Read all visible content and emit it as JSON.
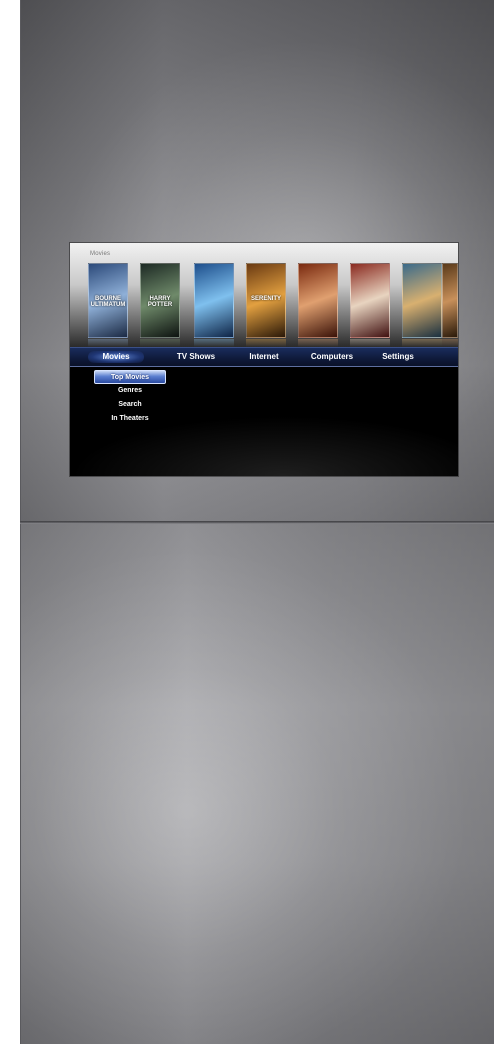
{
  "screen": {
    "section_title": "Movies",
    "posters": [
      {
        "name": "poster-bourne-ultimatum",
        "text": "BOURNE ULTIMATUM",
        "colors": [
          "#2c4a7a",
          "#8fb0d8",
          "#1b2a44"
        ]
      },
      {
        "name": "poster-harry-potter",
        "text": "HARRY POTTER",
        "colors": [
          "#1d2a24",
          "#6f8a6a",
          "#0d1310"
        ]
      },
      {
        "name": "poster-fantasy-film",
        "text": "",
        "colors": [
          "#1e4f8c",
          "#7fc0ee",
          "#0e2446"
        ]
      },
      {
        "name": "poster-serenity",
        "text": "SERENITY",
        "colors": [
          "#6a3a12",
          "#e2a040",
          "#2a1808"
        ]
      },
      {
        "name": "poster-action-film",
        "text": "",
        "colors": [
          "#7a2a10",
          "#e0a070",
          "#3a1208"
        ]
      },
      {
        "name": "poster-300",
        "text": "",
        "colors": [
          "#8a2a20",
          "#e8d4c0",
          "#401010"
        ]
      },
      {
        "name": "poster-animated-film",
        "text": "",
        "colors": [
          "#3a6a8a",
          "#d8b070",
          "#1a3040"
        ]
      },
      {
        "name": "poster-partial",
        "text": "",
        "colors": [
          "#5a3a1a",
          "#c8905a",
          "#2a1a0a"
        ]
      }
    ],
    "nav": {
      "movies": "Movies",
      "tv_shows": "TV Shows",
      "internet": "Internet",
      "computers": "Computers",
      "settings": "Settings"
    },
    "submenu": {
      "top_movies": "Top Movies",
      "genres": "Genres",
      "search": "Search",
      "in_theaters": "In Theaters"
    }
  }
}
